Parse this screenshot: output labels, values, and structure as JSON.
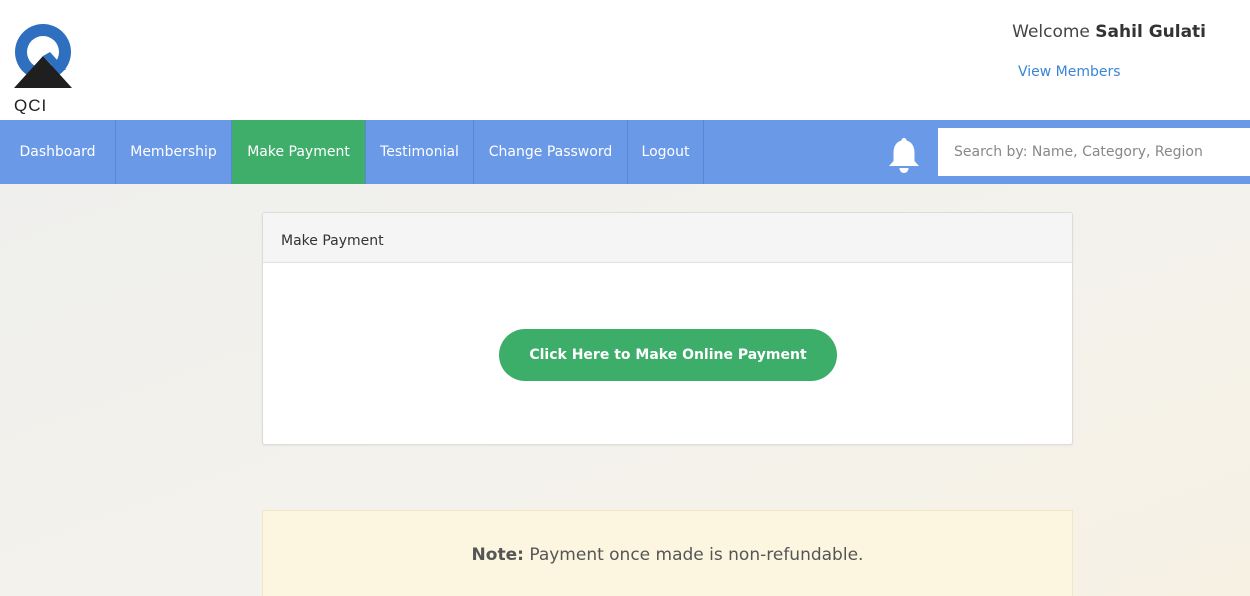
{
  "brand": {
    "logo_text": "QCI"
  },
  "header": {
    "welcome_prefix": "Welcome",
    "user_name": "Sahil Gulati",
    "view_members": "View Members"
  },
  "nav": {
    "items": [
      {
        "label": "Dashboard"
      },
      {
        "label": "Membership"
      },
      {
        "label": "Make Payment"
      },
      {
        "label": "Testimonial"
      },
      {
        "label": "Change Password"
      },
      {
        "label": "Logout"
      }
    ],
    "active_item": "Make Payment",
    "bell_icon": "bell-icon"
  },
  "search": {
    "placeholder": "Search by: Name, Category, Region",
    "value": ""
  },
  "panel": {
    "title": "Make Payment",
    "button_label": "Click Here to Make Online Payment"
  },
  "note": {
    "label": "Note:",
    "text": "Payment once made is non-refundable."
  },
  "colors": {
    "navbar": "#6a99e8",
    "active_nav": "#3fae6b",
    "pay_button": "#3dad6a",
    "link": "#3a85d8",
    "note_bg": "#fcf5df"
  }
}
